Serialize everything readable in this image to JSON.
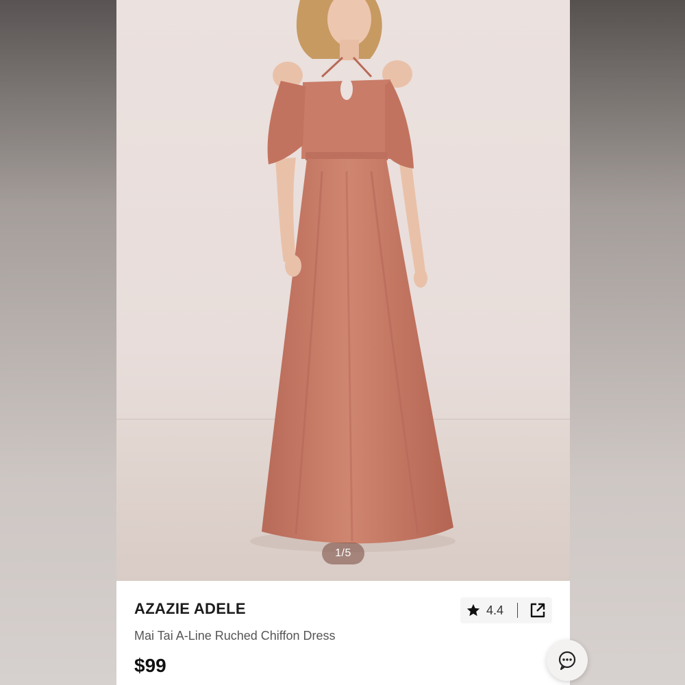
{
  "listing": {
    "image_counter": "1/5",
    "brand": "AZAZIE ADELE",
    "product_name": "Mai Tai A-Line Ruched Chiffon Dress",
    "price": "$99",
    "rating": "4.4"
  },
  "icons": {
    "rating": "star-icon",
    "share": "share-external-icon",
    "chat": "chat-bubble-icon"
  },
  "colors": {
    "dress": "#c97c68",
    "background_wall": "#ebe1de",
    "text_primary": "#1b1b1b",
    "text_secondary": "#555555"
  }
}
